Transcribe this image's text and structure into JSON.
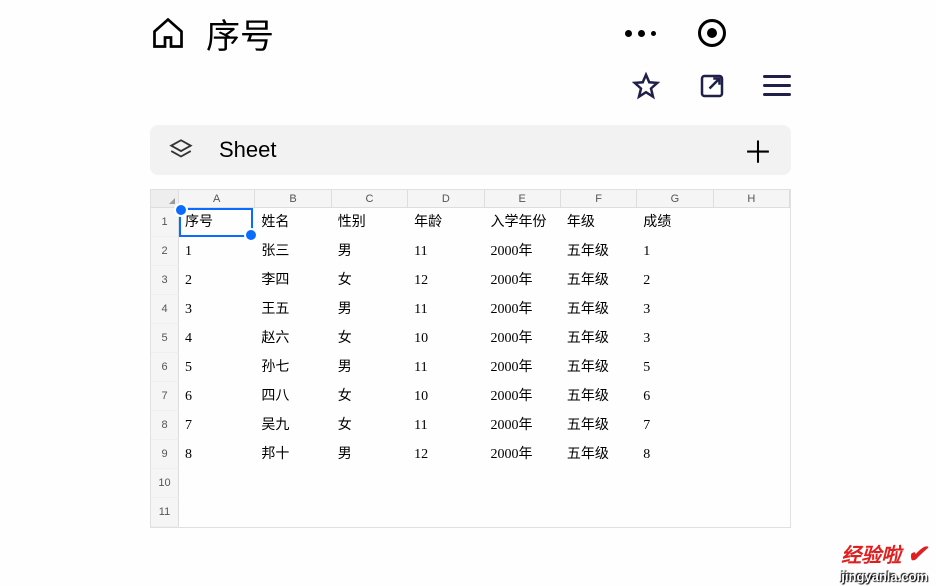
{
  "header": {
    "title": "序号"
  },
  "sheetbar": {
    "name": "Sheet"
  },
  "grid": {
    "columns": [
      "A",
      "B",
      "C",
      "D",
      "E",
      "F",
      "G",
      "H"
    ],
    "rows": [
      {
        "n": "1",
        "cells": [
          "序号",
          "姓名",
          "性别",
          "年龄",
          "入学年份",
          "年级",
          "成绩",
          ""
        ]
      },
      {
        "n": "2",
        "cells": [
          "1",
          "张三",
          "男",
          "11",
          "2000年",
          "五年级",
          "1",
          ""
        ]
      },
      {
        "n": "3",
        "cells": [
          "2",
          "李四",
          "女",
          "12",
          "2000年",
          "五年级",
          "2",
          ""
        ]
      },
      {
        "n": "4",
        "cells": [
          "3",
          "王五",
          "男",
          "11",
          "2000年",
          "五年级",
          "3",
          ""
        ]
      },
      {
        "n": "5",
        "cells": [
          "4",
          "赵六",
          "女",
          "10",
          "2000年",
          "五年级",
          "3",
          ""
        ]
      },
      {
        "n": "6",
        "cells": [
          "5",
          "孙七",
          "男",
          "11",
          "2000年",
          "五年级",
          "5",
          ""
        ]
      },
      {
        "n": "7",
        "cells": [
          "6",
          "四八",
          "女",
          "10",
          "2000年",
          "五年级",
          "6",
          ""
        ]
      },
      {
        "n": "8",
        "cells": [
          "7",
          "吴九",
          "女",
          "11",
          "2000年",
          "五年级",
          "7",
          ""
        ]
      },
      {
        "n": "9",
        "cells": [
          "8",
          "邦十",
          "男",
          "12",
          "2000年",
          "五年级",
          "8",
          ""
        ]
      },
      {
        "n": "10",
        "cells": [
          "",
          "",
          "",
          "",
          "",
          "",
          "",
          ""
        ]
      },
      {
        "n": "11",
        "cells": [
          "",
          "",
          "",
          "",
          "",
          "",
          "",
          ""
        ]
      }
    ],
    "selected_cell": "A1"
  },
  "watermark": {
    "text": "经验啦",
    "url": "jingyanla.com"
  }
}
